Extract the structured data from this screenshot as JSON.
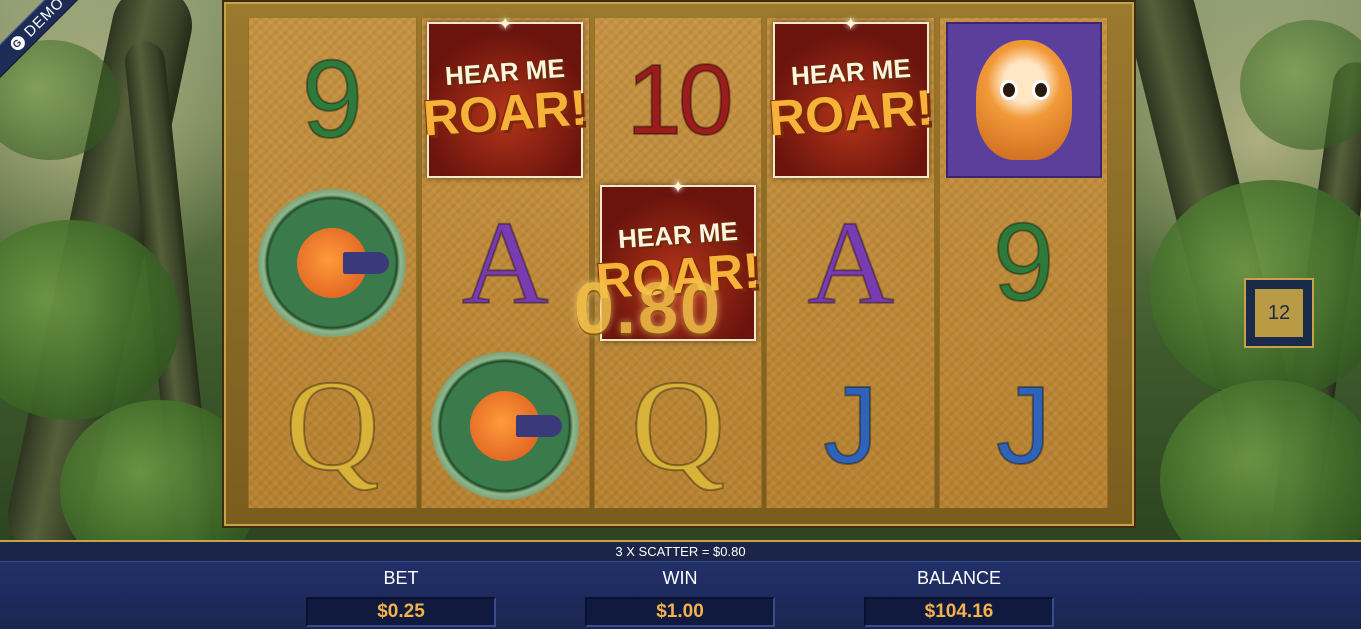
{
  "demo_badge": "DEMO",
  "reels": [
    [
      "9",
      "bird",
      "Q"
    ],
    [
      "scatter",
      "A",
      "bird"
    ],
    [
      "10",
      "scatter",
      "Q"
    ],
    [
      "scatter",
      "A",
      "J"
    ],
    [
      "tiger",
      "9",
      "J"
    ]
  ],
  "scatter_symbol": {
    "line1": "HEAR ME",
    "line2": "ROAR!"
  },
  "win_amount_overlay": "0.80",
  "free_spins_counter": "12",
  "message": "3 X SCATTER = $0.80",
  "stats": {
    "bet_label": "BET",
    "bet_value": "$0.25",
    "win_label": "WIN",
    "win_value": "$1.00",
    "balance_label": "BALANCE",
    "balance_value": "$104.16"
  },
  "colors": {
    "panel_navy": "#1a2548",
    "value_gold": "#f4b24a",
    "frame_gold": "#c8a24a"
  }
}
